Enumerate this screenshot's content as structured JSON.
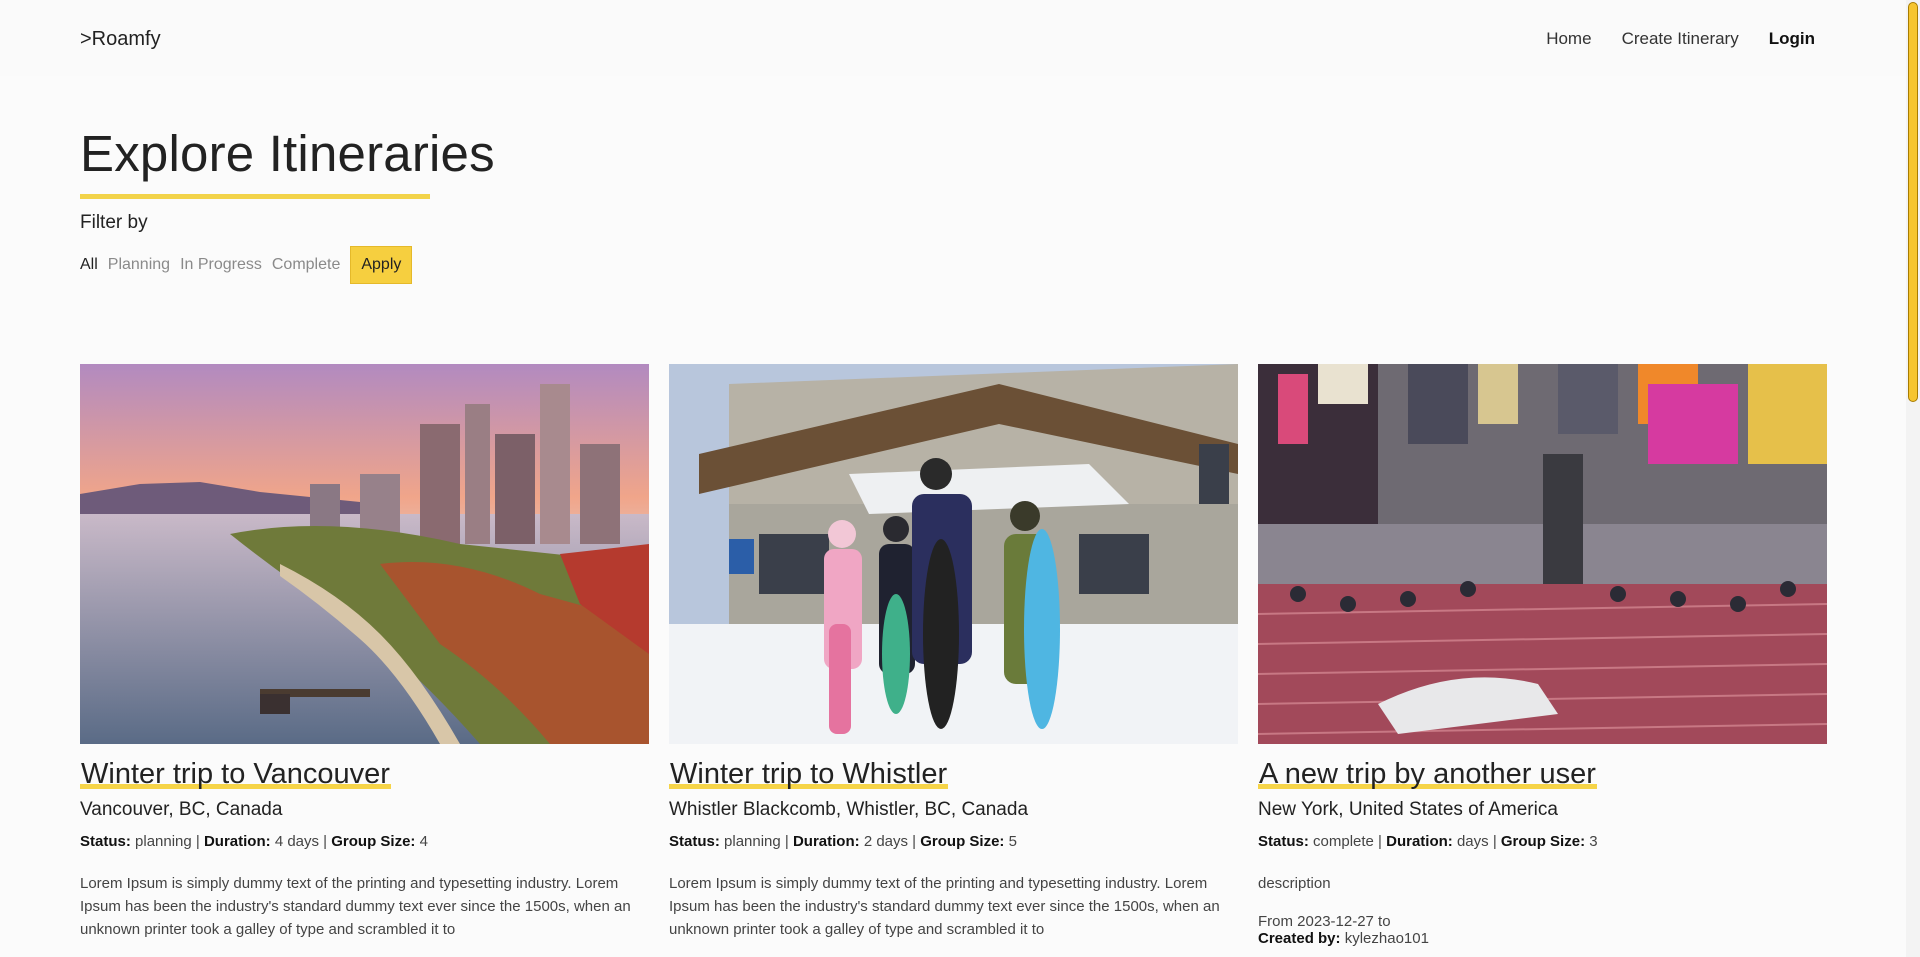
{
  "nav": {
    "logo": ">Roamfy",
    "links": [
      "Home",
      "Create Itinerary",
      "Login"
    ]
  },
  "page": {
    "title": "Explore Itineraries",
    "filter_label": "Filter by",
    "filters": [
      "All",
      "Planning",
      "In Progress",
      "Complete"
    ],
    "active_filter": "All",
    "apply_label": "Apply"
  },
  "labels": {
    "status": "Status:",
    "duration": "Duration:",
    "group_size": "Group Size:",
    "created_by": "Created by:"
  },
  "cards": [
    {
      "title": "Winter trip to Vancouver",
      "location": "Vancouver, BC, Canada",
      "status": "planning",
      "duration": "4 days",
      "group_size": "4",
      "description": "Lorem Ipsum is simply dummy text of the printing and typesetting industry. Lorem Ipsum has been the industry's standard dummy text ever since the 1500s, when an unknown printer took a galley of type and scrambled it to",
      "image": "vancouver-waterfront-photo"
    },
    {
      "title": "Winter trip to Whistler",
      "location": "Whistler Blackcomb, Whistler, BC, Canada",
      "status": "planning",
      "duration": "2 days",
      "group_size": "5",
      "description": "Lorem Ipsum is simply dummy text of the printing and typesetting industry. Lorem Ipsum has been the industry's standard dummy text ever since the 1500s, when an unknown printer took a galley of type and scrambled it to",
      "image": "snowboard-family-photo"
    },
    {
      "title": "A new trip by another user",
      "location": "New York, United States of America",
      "status": "complete",
      "duration": "days",
      "group_size": "3",
      "description": "description",
      "dates": "From 2023-12-27 to",
      "created_by": "kylezhao101",
      "image": "times-square-photo"
    }
  ],
  "colors": {
    "accent": "#f6cf3f",
    "underline": "#f2d34a"
  }
}
